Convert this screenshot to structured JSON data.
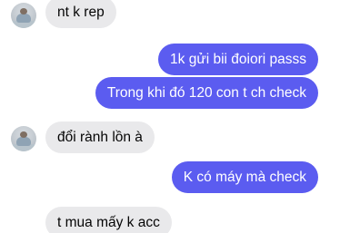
{
  "messages": [
    {
      "sender": "other",
      "text": "nt k rep",
      "show_avatar": true
    },
    {
      "sender": "me",
      "text": "1k gửi bii đoiori passs"
    },
    {
      "sender": "me",
      "text": "Trong khi đó 120 con t ch check"
    },
    {
      "sender": "other",
      "text": "đổi rành lồn à",
      "show_avatar": true
    },
    {
      "sender": "me",
      "text": "K có máy mà check"
    },
    {
      "sender": "other",
      "text": "t mua mấy k acc",
      "show_avatar": false
    }
  ],
  "icons": {
    "avatar": "contact-avatar"
  },
  "colors": {
    "outgoing_bubble": "#5b5cf0",
    "incoming_bubble": "#e9e9eb",
    "outgoing_text": "#ffffff",
    "incoming_text": "#050505"
  }
}
